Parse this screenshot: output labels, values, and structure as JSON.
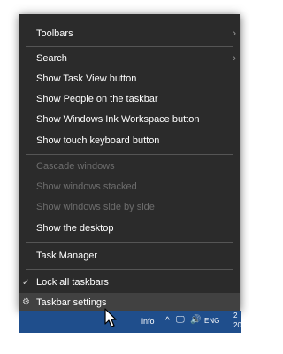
{
  "menu": {
    "toolbars": "Toolbars",
    "search": "Search",
    "show_task_view": "Show Task View button",
    "show_people": "Show People on the taskbar",
    "show_ink": "Show Windows Ink Workspace button",
    "show_touch_keyboard": "Show touch keyboard button",
    "cascade": "Cascade windows",
    "stacked": "Show windows stacked",
    "side_by_side": "Show windows side by side",
    "show_desktop": "Show the desktop",
    "task_manager": "Task Manager",
    "lock_taskbars": "Lock all taskbars",
    "taskbar_settings": "Taskbar settings",
    "submenu_glyph": "›",
    "check_glyph": "✓",
    "gear_glyph": "⚙"
  },
  "taskbar": {
    "info": "info",
    "chevron_up": "^",
    "network_glyph": "🖵",
    "volume_glyph": "🔊",
    "language": "ENG",
    "clock_partial_1": "2",
    "clock_partial_2": "20"
  },
  "colors": {
    "menu_bg": "#2b2b2b",
    "hover_bg": "#414141",
    "disabled_text": "#6d6d6d",
    "taskbar_bg": "#1f4e8c"
  }
}
